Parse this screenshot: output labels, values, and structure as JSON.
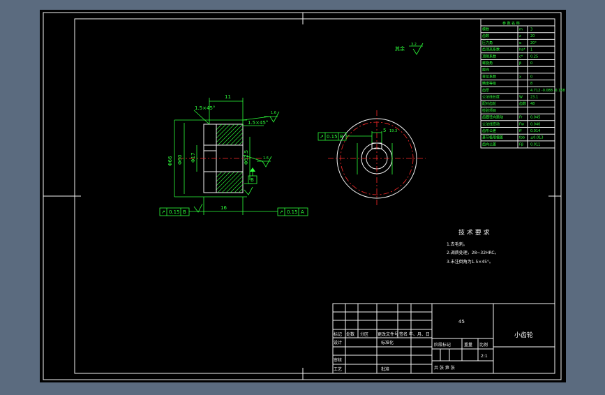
{
  "drawing": {
    "title": "小齿轮",
    "material": "45",
    "scale": "2:1",
    "roughness_note": "其余",
    "roughness_value": "3.2"
  },
  "tech_requirements": {
    "heading": "技 术 要 求",
    "items": [
      "1.去毛刺。",
      "2.调质处理，28~32HRC。",
      "3.未注倒角为1.5×45°。"
    ]
  },
  "params_table": {
    "header": "参 数 名 称",
    "rows": [
      [
        "模数",
        "m",
        "3"
      ],
      [
        "齿数",
        "z",
        "20"
      ],
      [
        "压力角",
        "α",
        "20°"
      ],
      [
        "齿顶高系数",
        "ha*",
        "1"
      ],
      [
        "顶隙系数",
        "c*",
        "0.25"
      ],
      [
        "螺旋角",
        "β",
        "0"
      ],
      [
        "旋向",
        "",
        ""
      ],
      [
        "变位系数",
        "x",
        "0"
      ],
      [
        "精度等级",
        "",
        "8"
      ],
      [
        "齿厚",
        "",
        "4.712 -0.088 -0.168"
      ],
      [
        "公法线长度",
        "W",
        "23.1"
      ],
      [
        "配对齿轮",
        "齿数",
        "48"
      ],
      [
        "检验项目",
        "",
        ""
      ],
      [
        "齿圈径向跳动",
        "Fr",
        "0.045"
      ],
      [
        "公法线变动",
        "Fw",
        "0.040"
      ],
      [
        "齿形公差",
        "ff",
        "0.014"
      ],
      [
        "基节极限偏差",
        "fpb",
        "±0.013"
      ],
      [
        "齿向公差",
        "Fβ",
        "0.011"
      ]
    ]
  },
  "dims": {
    "width": "11",
    "chamfer_1": "1.5×45°",
    "chamfer_2": "1.5×45°",
    "bore_dia": "Φ17",
    "tip_dia": "Φ66",
    "pitch_dia": "Φ60",
    "root_dia": "Φ52.5",
    "hub_len": "16",
    "keyway": "5",
    "key_depth": "19.3",
    "ra1": "1.6",
    "ra2": "1.6",
    "ra3": "3.2",
    "tol1_sym": "↗",
    "tol1_val": "0.15",
    "tol1_ref": "B",
    "tol2_sym": "↗",
    "tol2_val": "0.15",
    "tol2_ref": "A",
    "tol3_sym": "↗",
    "tol3_val": "0.15",
    "tol3_ref": "B",
    "datum_a": "A",
    "datum_b": "B"
  },
  "title_block": {
    "mark": "标记",
    "count": "处数",
    "zone": "分区",
    "change_no": "更改文件号",
    "sign_date": "签名  年、月、日",
    "designer": "设计",
    "standard": "标准化",
    "stage_mark": "阶段标记",
    "weight": "重量",
    "scale_label": "比例",
    "review": "审核",
    "process": "工艺",
    "approve": "批准",
    "sheets": "共    张  第    张"
  }
}
